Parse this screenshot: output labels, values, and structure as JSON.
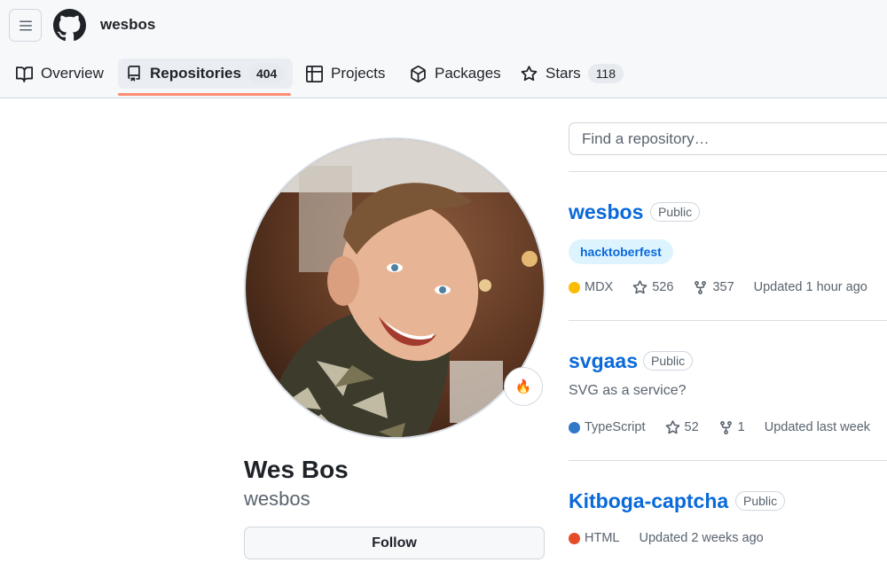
{
  "header": {
    "username": "wesbos",
    "tabs": [
      {
        "label": "Overview",
        "icon": "book-icon"
      },
      {
        "label": "Repositories",
        "icon": "repo-icon",
        "count": "404",
        "active": true
      },
      {
        "label": "Projects",
        "icon": "table-icon"
      },
      {
        "label": "Packages",
        "icon": "package-icon"
      },
      {
        "label": "Stars",
        "icon": "star-icon",
        "count": "118"
      }
    ],
    "underline_color": "#fd8c73"
  },
  "profile": {
    "full_name": "Wes Bos",
    "login": "wesbos",
    "status_emoji": "🔥",
    "follow_label": "Follow"
  },
  "search": {
    "placeholder": "Find a repository…"
  },
  "repos": [
    {
      "name": "wesbos",
      "visibility": "Public",
      "topic": "hacktoberfest",
      "language": "MDX",
      "language_color": "#fbbc05",
      "stars": "526",
      "forks": "357",
      "updated": "Updated 1 hour ago"
    },
    {
      "name": "svgaas",
      "visibility": "Public",
      "description": "SVG as a service?",
      "language": "TypeScript",
      "language_color": "#3178c6",
      "stars": "52",
      "forks": "1",
      "updated": "Updated last week"
    },
    {
      "name": "Kitboga-captcha",
      "visibility": "Public",
      "language": "HTML",
      "language_color": "#e34c26",
      "updated": "Updated 2 weeks ago"
    }
  ],
  "colors": {
    "link": "#0969da",
    "muted": "#59636e",
    "border": "#d0d7de"
  }
}
